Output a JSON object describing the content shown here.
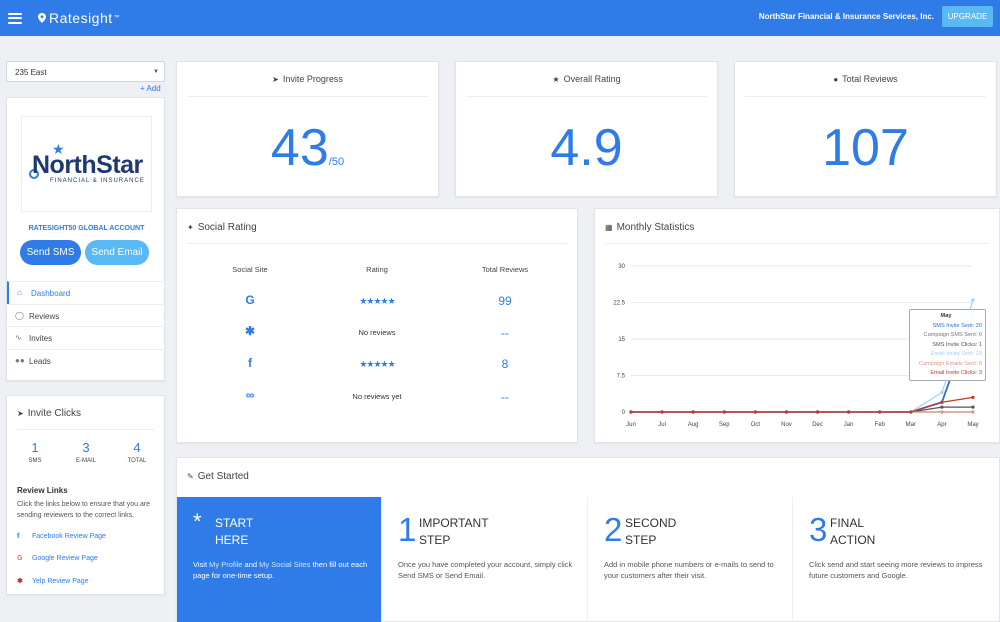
{
  "header": {
    "brand": "Ratesight",
    "brand_tm": "™",
    "company": "NorthStar Financial & Insurance Services, Inc.",
    "upgrade_label": "UPGRADE"
  },
  "sidebar": {
    "location": "235 East",
    "add_label": "+ Add",
    "logo": {
      "word": "NorthStar",
      "sub": "FINANCIAL & INSURANCE"
    },
    "account_label": "RATESIGHT50 GLOBAL ACCOUNT",
    "send_sms_label": "Send SMS",
    "send_email_label": "Send Email",
    "nav": [
      {
        "label": "Dashboard",
        "icon": "home-icon"
      },
      {
        "label": "Reviews",
        "icon": "comment-icon"
      },
      {
        "label": "Invites",
        "icon": "line-chart-icon"
      },
      {
        "label": "Leads",
        "icon": "users-icon"
      }
    ]
  },
  "invite_clicks": {
    "title": "Invite Clicks",
    "stats": [
      {
        "value": "1",
        "label": "SMS"
      },
      {
        "value": "3",
        "label": "E-MAIL"
      },
      {
        "value": "4",
        "label": "TOTAL"
      }
    ],
    "review_links_title": "Review Links",
    "review_links_desc": "Click the links below to ensure that you are sending reviewers to the correct links.",
    "links": [
      {
        "label": "Facebook Review Page",
        "icon": "facebook-icon"
      },
      {
        "label": "Google Review Page",
        "icon": "google-icon"
      },
      {
        "label": "Yelp Review Page",
        "icon": "yelp-icon"
      }
    ]
  },
  "top_stats": {
    "invite_progress": {
      "title": "Invite Progress",
      "value": "43",
      "suffix": "/50",
      "progress_fraction": 0.86
    },
    "overall_rating": {
      "title": "Overall Rating",
      "value": "4.9"
    },
    "total_reviews": {
      "title": "Total Reviews",
      "value": "107"
    }
  },
  "social_rating": {
    "title": "Social Rating",
    "columns": [
      "Social Site",
      "Rating",
      "Total Reviews"
    ],
    "rows": [
      {
        "site_icon": "google-icon",
        "rating": "★★★★★",
        "rating_stars": 5,
        "reviews": "99"
      },
      {
        "site_icon": "yelp-icon",
        "rating": "No reviews",
        "reviews": "--"
      },
      {
        "site_icon": "facebook-icon",
        "rating": "★★★★★",
        "rating_stars": 5,
        "reviews": "8"
      },
      {
        "site_icon": "link-icon",
        "rating": "No reviews yet",
        "reviews": "--"
      }
    ]
  },
  "monthly_statistics": {
    "title": "Monthly Statistics",
    "tooltip": {
      "month": "May",
      "lines": [
        {
          "text": "SMS Invite Sent: 20",
          "color": "#2a6fd1"
        },
        {
          "text": "Campaign SMS Sent: 0",
          "color": "#777777"
        },
        {
          "text": "SMS Invite Clicks: 1",
          "color": "#555555"
        },
        {
          "text": "Email Invite Sent: 23",
          "color": "#a7cdf3"
        },
        {
          "text": "Campaign Emails Sent: 0",
          "color": "#d99a7e"
        },
        {
          "text": "Email Invite Clicks: 3",
          "color": "#c0392b"
        }
      ]
    }
  },
  "chart_data": {
    "type": "line",
    "categories": [
      "Jun",
      "Jul",
      "Aug",
      "Sep",
      "Oct",
      "Nov",
      "Dec",
      "Jan",
      "Feb",
      "Mar",
      "Apr",
      "May"
    ],
    "ylim": [
      0,
      30
    ],
    "yticks": [
      "0",
      "7.5",
      "15",
      "22.5",
      "30"
    ],
    "grid": true,
    "series": [
      {
        "name": "SMS Invite Sent",
        "color": "#2a6fd1",
        "values": [
          0,
          0,
          0,
          0,
          0,
          0,
          0,
          0,
          0,
          0,
          2,
          20
        ]
      },
      {
        "name": "Campaign SMS Sent",
        "color": "#777777",
        "values": [
          0,
          0,
          0,
          0,
          0,
          0,
          0,
          0,
          0,
          0,
          0,
          0
        ]
      },
      {
        "name": "SMS Invite Clicks",
        "color": "#555555",
        "values": [
          0,
          0,
          0,
          0,
          0,
          0,
          0,
          0,
          0,
          0,
          1,
          1
        ]
      },
      {
        "name": "Email Invite Sent",
        "color": "#a7cdf3",
        "values": [
          0,
          0,
          0,
          0,
          0,
          0,
          0,
          0,
          0,
          0,
          4,
          23
        ]
      },
      {
        "name": "Campaign Emails Sent",
        "color": "#d99a7e",
        "values": [
          0,
          0,
          0,
          0,
          0,
          0,
          0,
          0,
          0,
          0,
          0,
          0
        ]
      },
      {
        "name": "Email Invite Clicks",
        "color": "#c0392b",
        "values": [
          0,
          0,
          0,
          0,
          0,
          0,
          0,
          0,
          0,
          0,
          2,
          3
        ]
      }
    ]
  },
  "get_started": {
    "title": "Get Started",
    "steps": [
      {
        "num": "*",
        "head_line1": "START",
        "head_line2": "HERE",
        "body_pre": "Visit ",
        "link1": "My Profile",
        "body_mid": " and ",
        "link2": "My Social Sites",
        "body_post": " then fill out each page for one-time setup."
      },
      {
        "num": "1",
        "head_line1": "IMPORTANT",
        "head_line2": "STEP",
        "body": "Once you have completed your account, simply click Send SMS or Send Email."
      },
      {
        "num": "2",
        "head_line1": "SECOND",
        "head_line2": "STEP",
        "body": "Add in mobile phone numbers or e-mails to send to your customers after their visit."
      },
      {
        "num": "3",
        "head_line1": "FINAL",
        "head_line2": "ACTION",
        "body": "Click send and start seeing more reviews to impress future customers and Google."
      }
    ]
  }
}
